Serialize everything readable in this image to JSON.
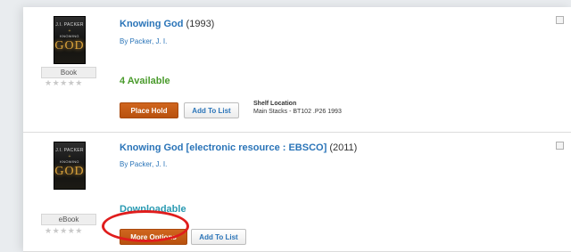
{
  "results": [
    {
      "cover": {
        "author_line": "J.I. PACKER",
        "plus": "+",
        "knowing_line": "KNOWING",
        "god_line": "GOD"
      },
      "format": "Book",
      "stars": "★★★★★",
      "title": "Knowing God",
      "year": "(1993)",
      "author": "By Packer, J. I.",
      "availability": "4 Available",
      "buttons": {
        "primary": "Place Hold",
        "secondary": "Add To List"
      },
      "shelf_label": "Shelf Location",
      "shelf_value": "Main Stacks - BT102 .P26 1993"
    },
    {
      "cover": {
        "author_line": "J.I. PACKER",
        "plus": "+",
        "knowing_line": "KNOWING",
        "god_line": "GOD"
      },
      "format": "eBook",
      "stars": "★★★★★",
      "title": "Knowing God [electronic resource : EBSCO]",
      "year": "(2011)",
      "author": "By Packer, J. I.",
      "availability": "Downloadable",
      "buttons": {
        "primary": "More Options",
        "secondary": "Add To List"
      }
    }
  ],
  "colors": {
    "link": "#2a74b8",
    "available": "#4a9b2c",
    "downloadable": "#2a9ab2",
    "button_orange": "#c95e1a",
    "highlight": "#e01d1d"
  }
}
